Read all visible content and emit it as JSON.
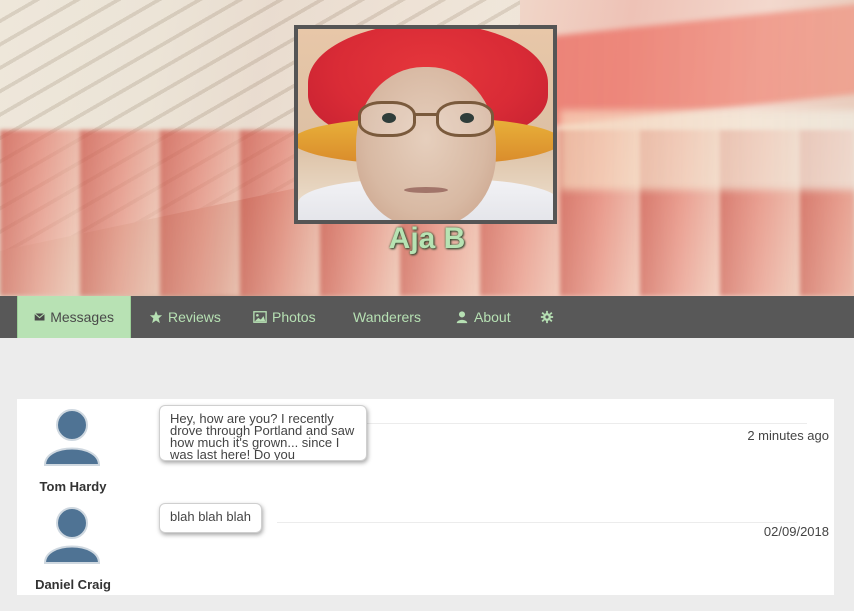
{
  "profile": {
    "name": "Aja B",
    "cover_image": "subway-train-motion",
    "avatar_image": "elderly-woman-red-hat"
  },
  "nav": {
    "items": [
      {
        "label": "Messages",
        "icon": "envelope-icon",
        "active": true
      },
      {
        "label": "Reviews",
        "icon": "star-icon",
        "active": false
      },
      {
        "label": "Photos",
        "icon": "image-icon",
        "active": false
      },
      {
        "label": "Wanderers",
        "icon": "",
        "active": false
      },
      {
        "label": "About",
        "icon": "user-icon",
        "active": false
      },
      {
        "label": "",
        "icon": "gear-icon",
        "active": false
      }
    ]
  },
  "messages": [
    {
      "sender": "Tom Hardy",
      "text": "Hey, how are you? I recently drove through Portland and saw how much it's grown... since I was last here! Do you",
      "time": "2 minutes ago"
    },
    {
      "sender": "Daniel Craig",
      "text": "blah blah blah",
      "time": "02/09/2018"
    }
  ],
  "colors": {
    "accent": "#b8e2b4",
    "nav_bg": "#585858",
    "page_bg": "#ececec"
  }
}
